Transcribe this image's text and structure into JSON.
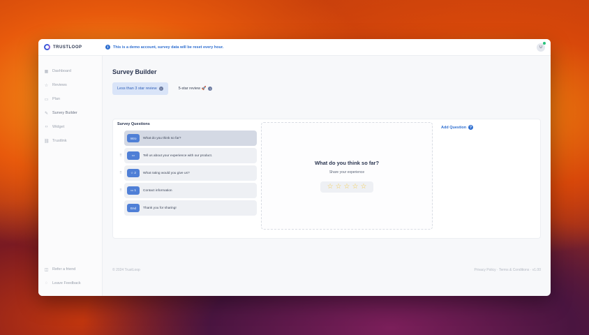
{
  "brand": {
    "name": "TRUSTLOOP"
  },
  "notice": {
    "text": "This is a demo account, survey data will be reset every hour."
  },
  "user": {
    "initials": "U"
  },
  "sidebar": {
    "items": [
      {
        "label": "Dashboard",
        "icon": "grid-icon"
      },
      {
        "label": "Reviews",
        "icon": "star-icon"
      },
      {
        "label": "Plan",
        "icon": "card-icon"
      },
      {
        "label": "Survey Builder",
        "icon": "pencil-icon"
      },
      {
        "label": "Widget",
        "icon": "code-icon"
      },
      {
        "label": "Trustlink",
        "icon": "link-icon"
      }
    ],
    "bottom": [
      {
        "label": "Refer a friend",
        "icon": "gift-icon"
      },
      {
        "label": "Leave Feedback",
        "icon": "chat-icon"
      }
    ]
  },
  "page": {
    "title": "Survey Builder"
  },
  "tabs": [
    {
      "label": "Less than 3 star review"
    },
    {
      "label": "5-star review 🚀"
    }
  ],
  "questions": {
    "title": "Survey Questions",
    "items": [
      {
        "badge": "Intro",
        "text": "What do you think so far?"
      },
      {
        "badge": "▭",
        "text": "Tell us about your experience with our product."
      },
      {
        "badge": "☆ 2",
        "text": "What rating would you give us?"
      },
      {
        "badge": "▭ 1",
        "text": "Contact information"
      },
      {
        "badge": "End",
        "text": "Thank you for sharing!"
      }
    ]
  },
  "preview": {
    "title": "What do you think so far?",
    "subtitle": "Share your experience",
    "stars": [
      "☆",
      "☆",
      "☆",
      "☆",
      "☆"
    ]
  },
  "add_question": {
    "label": "Add Question"
  },
  "footer": {
    "left": "© 2024 TrustLoop",
    "right": "Privacy Policy · Terms & Conditions · v1.00"
  },
  "colors": {
    "accent": "#2f6fd0",
    "badge": "#4f7fd6",
    "star": "#f2c94c"
  }
}
